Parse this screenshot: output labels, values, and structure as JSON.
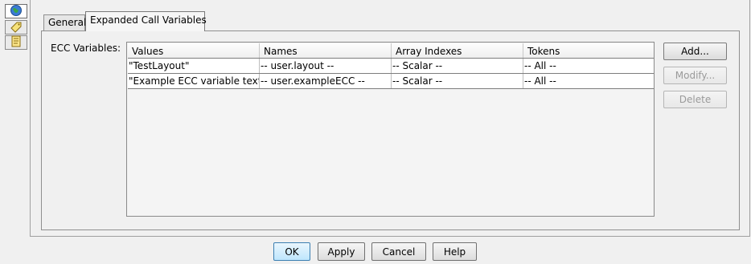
{
  "icons": [
    "globe-icon",
    "tag-icon",
    "note-icon"
  ],
  "tabs": [
    {
      "label": "General",
      "selected": false
    },
    {
      "label": "Expanded Call Variables",
      "selected": true
    }
  ],
  "ecc": {
    "label": "ECC Variables:",
    "columns": [
      "Values",
      "Names",
      "Array Indexes",
      "Tokens"
    ],
    "rows": [
      [
        "\"TestLayout\"",
        "-- user.layout --",
        "-- Scalar --",
        "-- All --"
      ],
      [
        "\"Example ECC variable text.\"",
        "-- user.exampleECC --",
        "-- Scalar --",
        "-- All --"
      ]
    ]
  },
  "side_buttons": {
    "add": "Add...",
    "modify": "Modify...",
    "delete": "Delete"
  },
  "dialog_buttons": {
    "ok": "OK",
    "apply": "Apply",
    "cancel": "Cancel",
    "help": "Help"
  }
}
